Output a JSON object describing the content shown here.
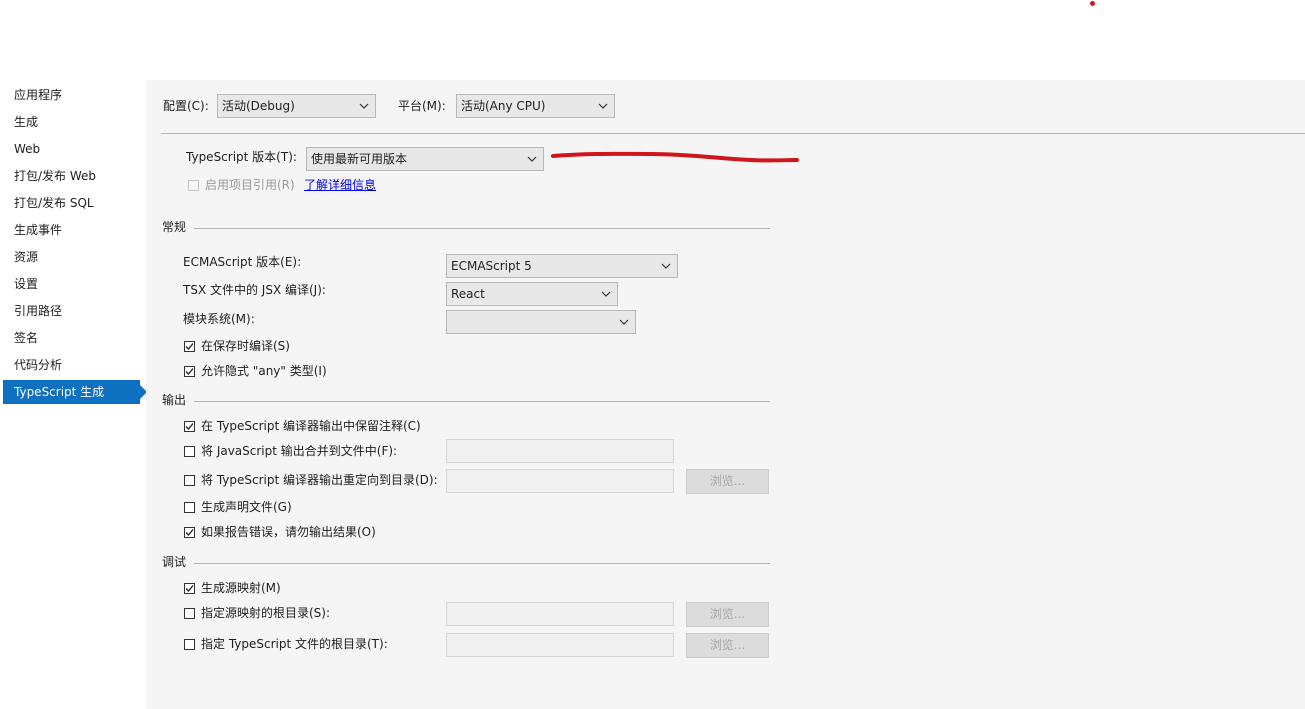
{
  "sidebar": {
    "items": [
      {
        "label": "应用程序"
      },
      {
        "label": "生成"
      },
      {
        "label": "Web"
      },
      {
        "label": "打包/发布 Web"
      },
      {
        "label": "打包/发布 SQL"
      },
      {
        "label": "生成事件"
      },
      {
        "label": "资源"
      },
      {
        "label": "设置"
      },
      {
        "label": "引用路径"
      },
      {
        "label": "签名"
      },
      {
        "label": "代码分析"
      },
      {
        "label": "TypeScript 生成"
      }
    ],
    "active_item": "TypeScript 生成"
  },
  "toolbar": {
    "config_label": "配置(C):",
    "config_value": "活动(Debug)",
    "platform_label": "平台(M):",
    "platform_value": "活动(Any CPU)"
  },
  "typescript": {
    "version_label": "TypeScript 版本(T):",
    "version_value": "使用最新可用版本",
    "enable_project_refs_label": "启用项目引用(R)",
    "learn_more_link": "了解详细信息"
  },
  "general": {
    "heading": "常规",
    "ecma_label": "ECMAScript 版本(E):",
    "ecma_value": "ECMAScript 5",
    "jsx_label": "TSX 文件中的 JSX 编译(J):",
    "jsx_value": "React",
    "module_label": "模块系统(M):",
    "module_value": "",
    "compile_on_save_label": "在保存时编译(S)",
    "compile_on_save_checked": true,
    "allow_implicit_any_label": "允许隐式 \"any\" 类型(I)",
    "allow_implicit_any_checked": true
  },
  "output": {
    "heading": "输出",
    "keep_comments_label": "在 TypeScript 编译器输出中保留注释(C)",
    "keep_comments_checked": true,
    "combine_js_label": "将 JavaScript 输出合并到文件中(F):",
    "combine_js_checked": false,
    "redirect_output_label": "将 TypeScript 编译器输出重定向到目录(D):",
    "redirect_output_checked": false,
    "browse_label": "浏览...",
    "generate_declarations_label": "生成声明文件(G)",
    "generate_declarations_checked": false,
    "no_emit_on_error_label": "如果报告错误，请勿输出结果(O)",
    "no_emit_on_error_checked": true
  },
  "debug": {
    "heading": "调试",
    "generate_source_maps_label": "生成源映射(M)",
    "generate_source_maps_checked": true,
    "source_map_root_label": "指定源映射的根目录(S):",
    "source_map_root_checked": false,
    "ts_root_label": "指定 TypeScript 文件的根目录(T):",
    "ts_root_checked": false,
    "browse_label": "浏览..."
  },
  "colors": {
    "accent": "#0e70c0",
    "annotation_stroke": "#d0161a",
    "panel_bg": "#f5f5f5"
  }
}
